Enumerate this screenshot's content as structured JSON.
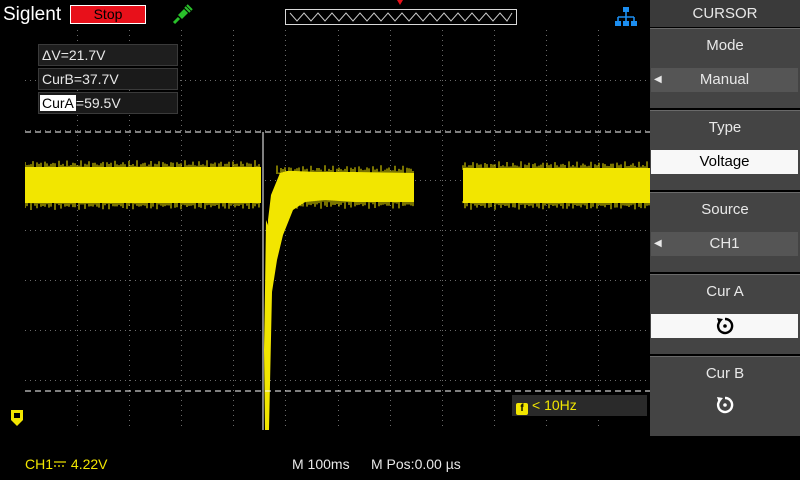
{
  "header": {
    "brand": "Siglent",
    "run_state": "Stop",
    "run_state_color": "#e8101a"
  },
  "waveform": {
    "trace_color": "#f2e600",
    "cursor_color": "#ffffff"
  },
  "cursor_readout": {
    "delta_v": "ΔV=21.7V",
    "cur_b": "CurB=37.7V",
    "cur_a_label": "CurA",
    "cur_a_value": "=59.5V"
  },
  "trigger": {
    "freq_icon": "f",
    "freq_text": "< 10Hz"
  },
  "status": {
    "ch1_label": "CH1",
    "ch1_coupling_icon": "dc-coupling-icon",
    "ch1_scale": "4.22V",
    "timebase": "M 100ms",
    "hpos": "M Pos:0.00 µs"
  },
  "menu": {
    "title": "CURSOR",
    "mode_label": "Mode",
    "mode_value": "Manual",
    "type_label": "Type",
    "type_value": "Voltage",
    "source_label": "Source",
    "source_value": "CH1",
    "cura_label": "Cur A",
    "curb_label": "Cur B"
  }
}
